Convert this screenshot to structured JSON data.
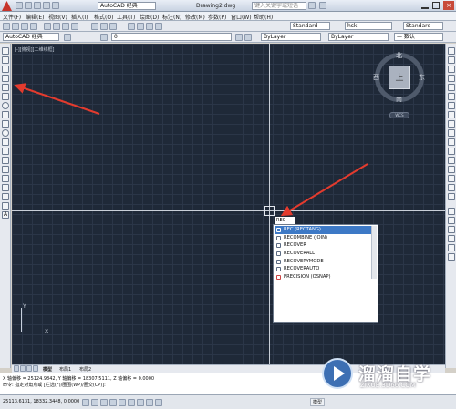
{
  "window": {
    "title": "Drawing2.dwg",
    "workspace": "AutoCAD 经典",
    "search_placeholder": "键入关键字或短语"
  },
  "menu": [
    "文件(F)",
    "编辑(E)",
    "视图(V)",
    "插入(I)",
    "格式(O)",
    "工具(T)",
    "绘图(D)",
    "标注(N)",
    "修改(M)",
    "参数(P)",
    "窗口(W)",
    "帮助(H)"
  ],
  "toolbar": {
    "workspace_combo": "AutoCAD 经典",
    "layer_combo": "0",
    "color_combo": "ByLayer",
    "linetype_combo": "ByLayer",
    "lineweight_combo": "— 数认",
    "textstyle_combo": "Standard",
    "dimstyle_combo": "hsk",
    "tablestyle_combo": "Standard"
  },
  "viewport": {
    "label": "[-][俯视][二维线框]"
  },
  "viewcube": {
    "north": "北",
    "south": "南",
    "west": "西",
    "east": "东",
    "top": "上",
    "wcs": "WCS"
  },
  "ucs": {
    "x": "X",
    "y": "Y"
  },
  "command_input": "REC",
  "autocomplete": {
    "items": [
      "REC (RECTANG)",
      "RECOMBINE (JOIN)",
      "RECOVER",
      "RECOVERALL",
      "RECOVERYMODE",
      "RECOVERAUTO",
      "PRECISION (OSNAP)"
    ],
    "selected": 0
  },
  "layout_tabs": [
    "模型",
    "布局1",
    "布局2"
  ],
  "command_history": {
    "line1": "X 轴偏移 = 25124.9842, Y 轴偏移 = 18307.5111, Z 轴偏移 = 0.0000",
    "line2": "命令: 指定对角点或 [栏选(F)/圈围(WP)/圈交(CP)]:"
  },
  "status": {
    "coords": "25113.6131, 18332.3448, 0.0000",
    "model": "模型"
  },
  "watermark": {
    "brand": "溜溜自学",
    "url": "ZIXUE.3D66.COM"
  }
}
